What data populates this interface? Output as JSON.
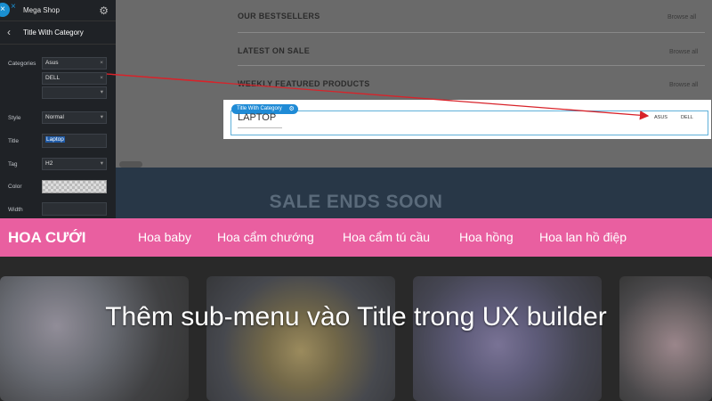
{
  "builder": {
    "app_title": "Mega Shop",
    "element_title": "Title With Category",
    "fields": {
      "categories_label": "Categories",
      "categories_values": [
        "Asus",
        "DELL",
        ""
      ],
      "style_label": "Style",
      "style_value": "Normal",
      "title_label": "Title",
      "title_value": "Laptop",
      "tag_label": "Tag",
      "tag_value": "H2",
      "color_label": "Color",
      "width_label": "Width"
    },
    "icons": {
      "close": "×",
      "gear": "⚙",
      "back": "‹",
      "remove": "×",
      "caret": "▾"
    }
  },
  "canvas": {
    "sections": [
      {
        "title": "OUR BESTSELLERS",
        "link": "Browse all"
      },
      {
        "title": "LATEST ON SALE",
        "link": "Browse all"
      },
      {
        "title": "WEEKLY FEATURED PRODUCTS",
        "link": "Browse all"
      }
    ],
    "badge_label": "Title With Category",
    "heading": "LAPTOP",
    "category_links": [
      "ASUS",
      "DELL"
    ],
    "sale_banner": "SALE ENDS SOON"
  },
  "nav": {
    "brand": "HOA CƯỚI",
    "items": [
      "Hoa baby",
      "Hoa cẩm chướng",
      "Hoa cẩm tú cầu",
      "Hoa hồng",
      "Hoa lan hồ điệp"
    ]
  },
  "headline": "Thêm sub-menu vào Title trong UX builder",
  "colors": {
    "nav_pink": "#e95fa0",
    "accent_blue": "#1f8bd6",
    "arrow_red": "#d8232a"
  }
}
